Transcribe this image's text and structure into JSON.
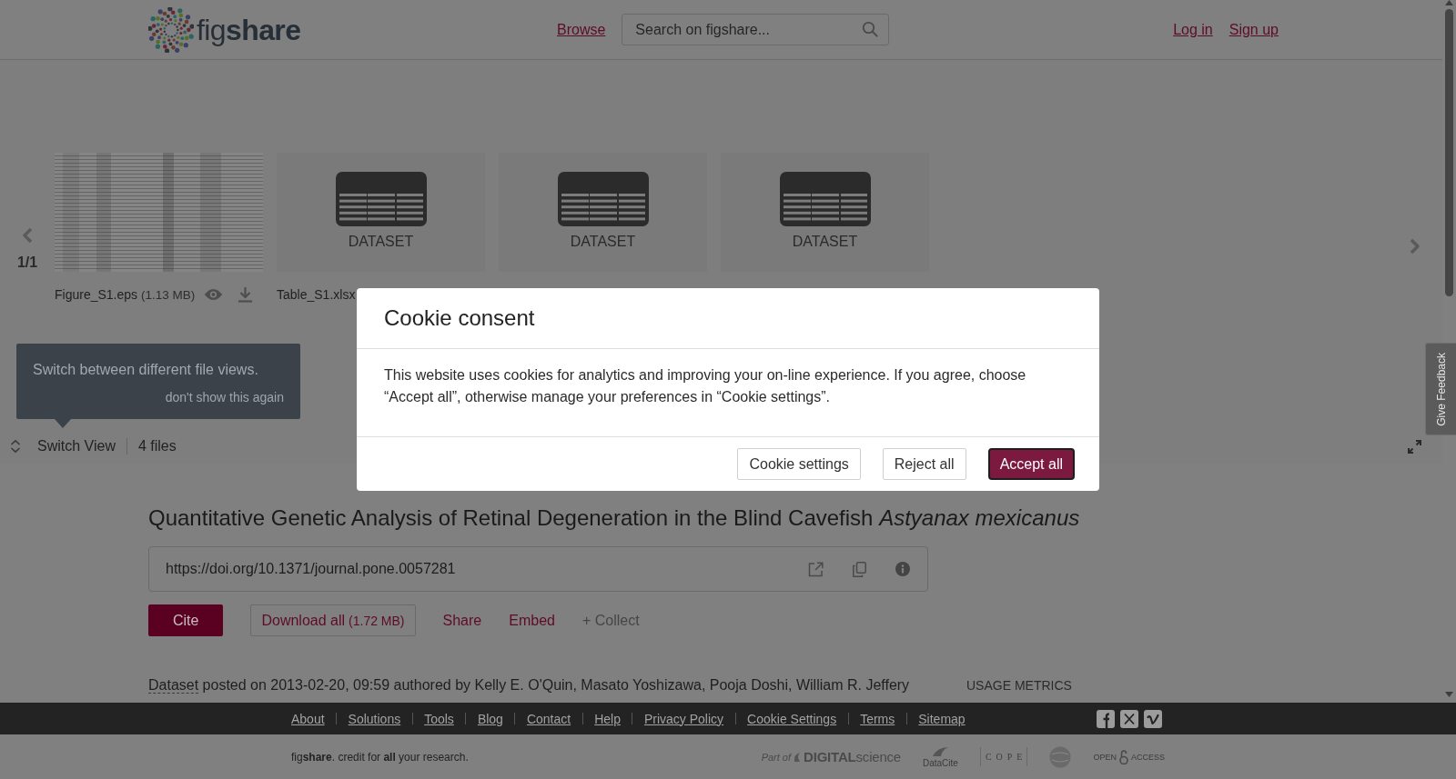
{
  "header": {
    "logo": {
      "text": "fig**share**"
    },
    "nav_link": "Browse",
    "search": {
      "placeholder": "Search on figshare..."
    },
    "auth_links": [
      "Log in",
      "Sign up"
    ]
  },
  "viewer": {
    "pager": "1/1",
    "tiles": [
      {
        "kind": "image",
        "name": "Figure_S1.eps",
        "size": "(1.13 MB)"
      },
      {
        "kind": "dataset",
        "label": "DATASET",
        "name": "Table_S1.xlsx"
      },
      {
        "kind": "dataset",
        "label": "DATASET"
      },
      {
        "kind": "dataset",
        "label": "DATASET"
      }
    ],
    "tooltip": {
      "text": "Switch between different file views.",
      "dismiss": "don't show this again"
    },
    "switch_view": "Switch View",
    "file_count": "4 files"
  },
  "feedback_tab": "Give Feedback",
  "item": {
    "title": "Quantitative Genetic Analysis of Retinal Degeneration in the Blind Cavefish *Astyanax mexicanus*",
    "doi": "https://doi.org/10.1371/journal.pone.0057281",
    "actions": [
      {
        "kind": "primary",
        "label": "Cite"
      },
      {
        "kind": "outline",
        "label": "Download all",
        "size": "(1.72 MB)"
      },
      {
        "kind": "link",
        "label": "Share"
      },
      {
        "kind": "link",
        "label": "Embed"
      },
      {
        "kind": "muted",
        "label": "+ Collect"
      }
    ],
    "meta": {
      "type_link": "Dataset",
      "text": "posted on 2013-02-20, 09:59 authored by Kelly E. O'Quin, Masato Yoshizawa, Pooja Doshi, William R. Jeffery"
    },
    "usage_metrics": "USAGE METRICS"
  },
  "footer": {
    "links": [
      "About",
      "Solutions",
      "Tools",
      "Blog",
      "Contact",
      "Help",
      "Privacy Policy",
      "Cookie Settings",
      "Terms",
      "Sitemap"
    ],
    "social": [
      {
        "kind": "facebook"
      },
      {
        "kind": "x"
      },
      {
        "kind": "vimeo"
      }
    ],
    "tagline": "fig**share**. credit for **all** your research.",
    "partners": [
      {
        "kind": "digital_science",
        "prefix": "Part of",
        "name": "**DIGITAL**science"
      },
      {
        "kind": "datacite",
        "name": "DataCite"
      },
      {
        "kind": "cope",
        "name": "COPE"
      },
      {
        "kind": "globe"
      },
      {
        "kind": "open_access",
        "words": [
          "OPEN",
          "ACCESS"
        ]
      }
    ]
  },
  "cookie_dialog": {
    "title": "Cookie consent",
    "body": "This website uses cookies for analytics and improving your on-line experience. If you agree, choose “Accept all”, otherwise manage your preferences in “Cookie settings”.",
    "buttons": [
      {
        "kind": "secondary",
        "label": "Cookie settings",
        "focused": false
      },
      {
        "kind": "secondary",
        "label": "Reject all",
        "focused": false
      },
      {
        "kind": "primary",
        "label": "Accept all",
        "focused": true
      }
    ]
  }
}
